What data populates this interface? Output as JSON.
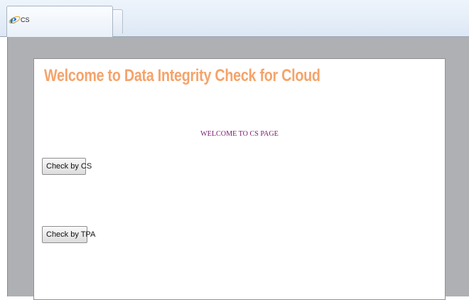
{
  "browser": {
    "tab_title": "CS",
    "tab_icon": "internet-explorer-icon"
  },
  "page": {
    "title": "Welcome to Data  Integrity Check for Cloud",
    "welcome_text": "WELCOME TO CS PAGE",
    "check_cs_label": "Check by CS",
    "check_tpa_label": "Check by TPA"
  },
  "colors": {
    "title": "#f5a36a",
    "welcome": "#7a1a6f",
    "viewport_background": "#aeb0b4"
  }
}
